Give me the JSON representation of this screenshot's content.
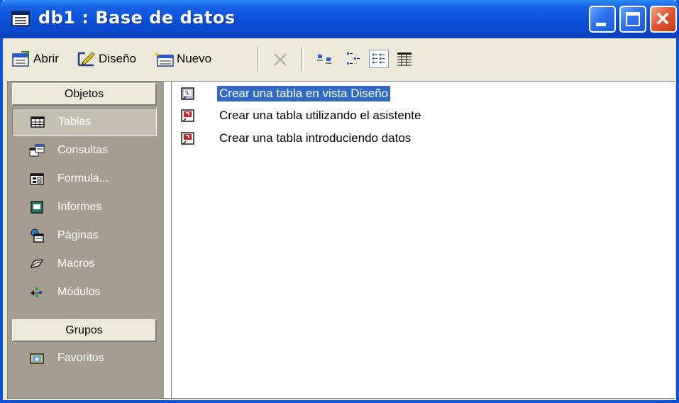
{
  "window": {
    "title": "db1 : Base de datos"
  },
  "toolbar": {
    "abrir_label": "Abrir",
    "diseno_label": "Diseño",
    "nuevo_label": "Nuevo"
  },
  "objects_bar": {
    "objects_header": "Objetos",
    "objects": [
      {
        "label": "Tablas",
        "icon": "table-icon",
        "selected": true
      },
      {
        "label": "Consultas",
        "icon": "query-icon",
        "selected": false
      },
      {
        "label": "Formula...",
        "icon": "form-icon",
        "selected": false
      },
      {
        "label": "Informes",
        "icon": "report-icon",
        "selected": false
      },
      {
        "label": "Páginas",
        "icon": "page-icon",
        "selected": false
      },
      {
        "label": "Macros",
        "icon": "macro-icon",
        "selected": false
      },
      {
        "label": "Módulos",
        "icon": "module-icon",
        "selected": false
      }
    ],
    "groups_header": "Grupos",
    "groups": [
      {
        "label": "Favoritos",
        "icon": "favorites-icon"
      }
    ]
  },
  "list": {
    "items": [
      {
        "label": "Crear una tabla en vista Diseño",
        "icon": "design-view-shortcut-icon",
        "selected": true
      },
      {
        "label": "Crear una tabla utilizando el asistente",
        "icon": "wizard-shortcut-icon",
        "selected": false
      },
      {
        "label": "Crear una tabla introduciendo datos",
        "icon": "datasheet-shortcut-icon",
        "selected": false
      }
    ]
  },
  "colors": {
    "titlebar": "#0a4fd8",
    "selection": "#316ac5",
    "objects_bar": "#a59e90"
  }
}
